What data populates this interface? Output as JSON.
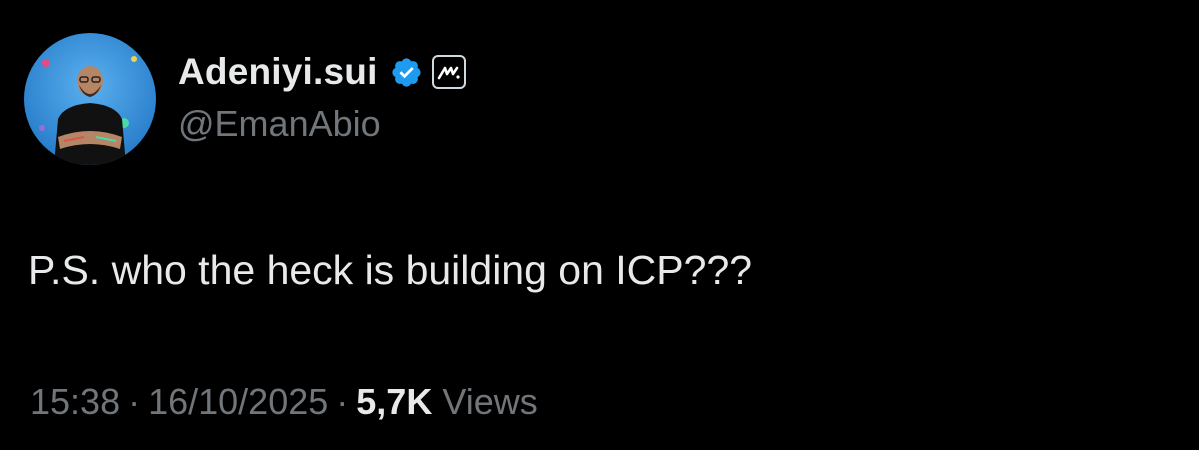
{
  "author": {
    "display_name": "Adeniyi.sui",
    "handle": "@EmanAbio",
    "verified_icon": "verified-badge-icon",
    "affiliate_icon": "affiliate-m-logo-icon",
    "verified_color": "#1d9bf0"
  },
  "tweet": {
    "text": "P.S. who the heck is building on ICP???"
  },
  "meta": {
    "time": "15:38",
    "separator": "·",
    "date": "16/10/2025",
    "views_count": "5,7K",
    "views_label": "Views"
  },
  "colors": {
    "background": "#000000",
    "primary_text": "#e7e9ea",
    "secondary_text": "#71767b",
    "avatar_background": "#2f8fd8"
  }
}
